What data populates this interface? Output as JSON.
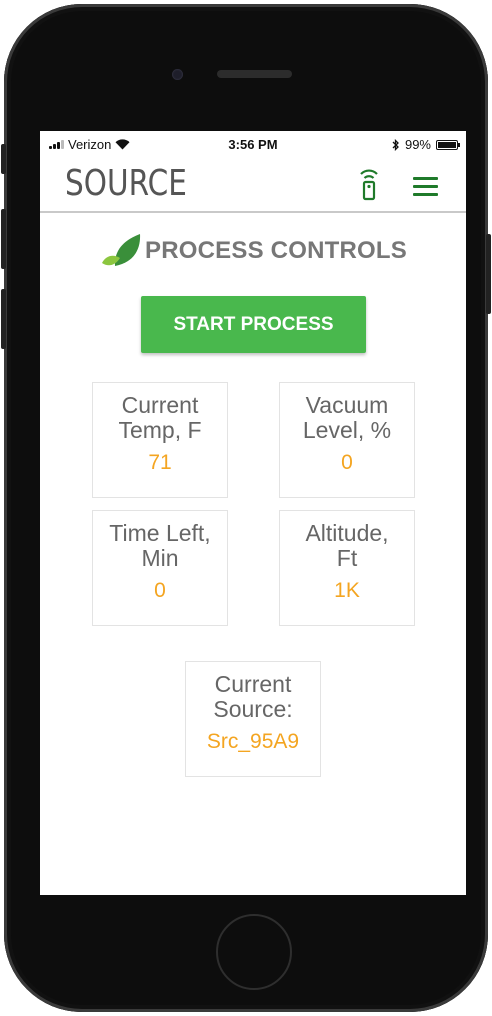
{
  "status_bar": {
    "carrier": "Verizon",
    "time": "3:56 PM",
    "battery": "99%",
    "battery_level": 0.99,
    "icons": [
      "signal-icon",
      "wifi-icon",
      "bluetooth-icon",
      "battery-icon"
    ]
  },
  "header": {
    "logo": "SOURCE",
    "icons": [
      "remote-icon",
      "menu-icon"
    ],
    "accent": "#1f7a2a"
  },
  "page": {
    "title": "PROCESS CONTROLS",
    "title_icon": "leaf-icon",
    "start_button": "START PROCESS"
  },
  "metrics": [
    {
      "label": "Current\nTemp, F",
      "value": "71"
    },
    {
      "label": "Vacuum\nLevel, %",
      "value": "0"
    },
    {
      "label": "Time Left,\nMin",
      "value": "0"
    },
    {
      "label": "Altitude,\nFt",
      "value": "1K"
    },
    {
      "label": "Current\nSource:",
      "value": "Src_95A9"
    }
  ],
  "colors": {
    "button": "#49b84d",
    "value": "#f4a521",
    "label": "#666666"
  }
}
